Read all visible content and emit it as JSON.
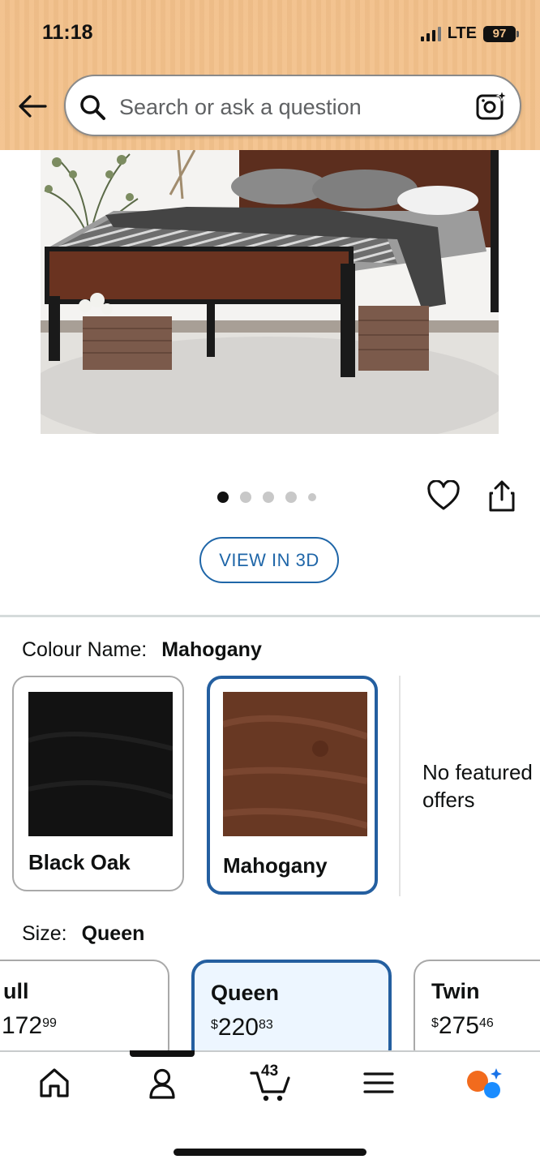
{
  "status_bar": {
    "time": "11:18",
    "network": "LTE",
    "battery": "97"
  },
  "search": {
    "placeholder": "Search or ask a question"
  },
  "image_carousel": {
    "dots": 5,
    "active_index": 0
  },
  "view3d": {
    "label": "VIEW IN 3D"
  },
  "colour": {
    "label": "Colour Name:",
    "selected": "Mahogany",
    "options": [
      {
        "name": "Black Oak",
        "color": "#141414"
      },
      {
        "name": "Mahogany",
        "color": "#6b3a26"
      }
    ],
    "no_featured_text": "No featured offers"
  },
  "size": {
    "label": "Size:",
    "selected": "Queen",
    "options": [
      {
        "name": "Full",
        "visible_name": "ull",
        "currency": "$",
        "whole": "172",
        "visible_whole": "172",
        "cents": "99"
      },
      {
        "name": "Queen",
        "currency": "$",
        "whole": "220",
        "cents": "83"
      },
      {
        "name": "Twin",
        "currency": "$",
        "whole": "275",
        "cents": "46"
      }
    ]
  },
  "bottom_nav": {
    "items": [
      "home-icon",
      "account-icon",
      "cart-icon",
      "menu-icon",
      "rufus-icon"
    ],
    "cart_count": "43"
  },
  "colors": {
    "accent_blue": "#245fa0",
    "header_bg": "#f3c28c"
  }
}
